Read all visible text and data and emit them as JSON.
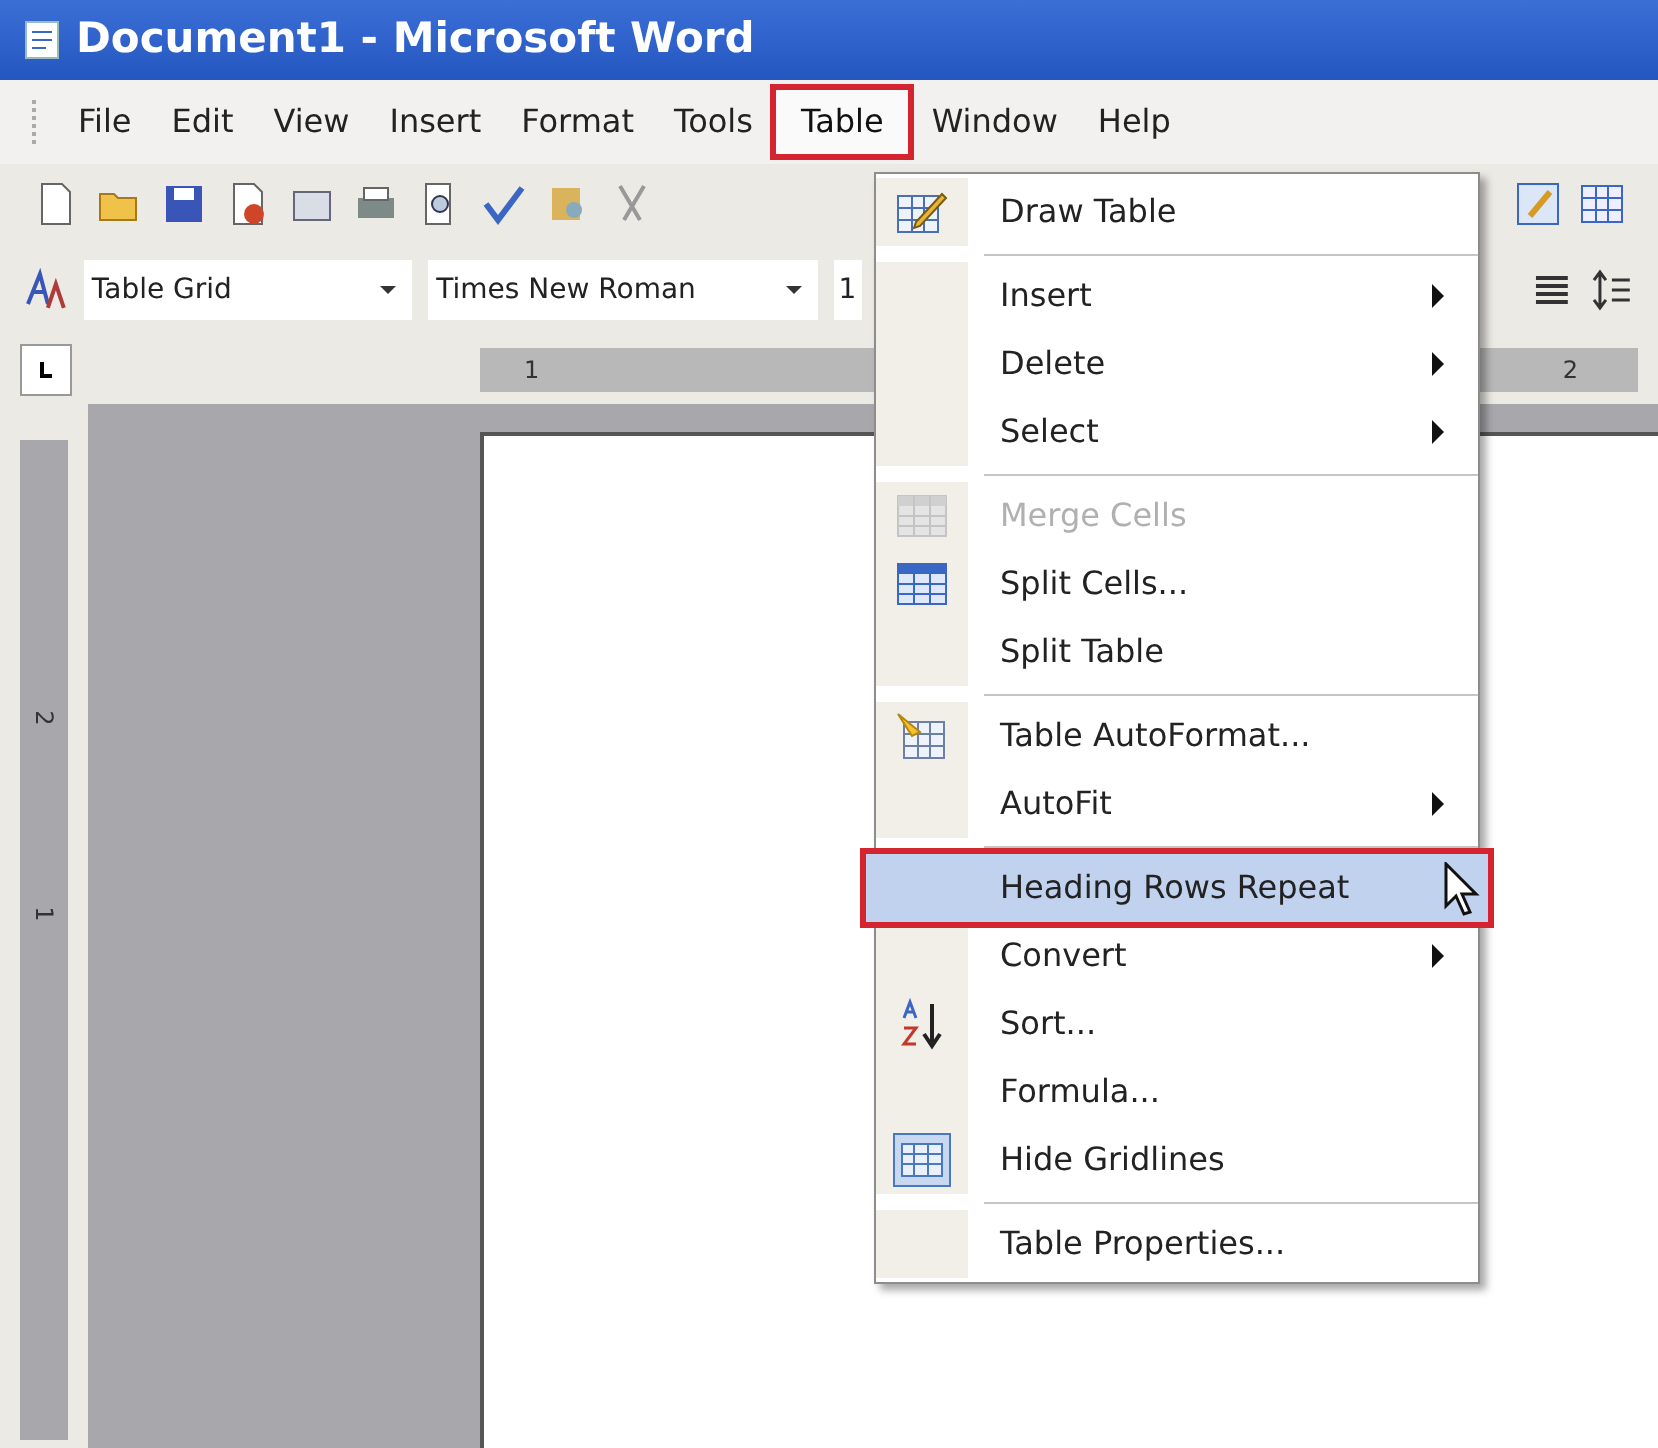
{
  "window": {
    "title": "Document1 - Microsoft Word"
  },
  "menu_bar": [
    {
      "label": "File",
      "selected": false
    },
    {
      "label": "Edit",
      "selected": false
    },
    {
      "label": "View",
      "selected": false
    },
    {
      "label": "Insert",
      "selected": false
    },
    {
      "label": "Format",
      "selected": false
    },
    {
      "label": "Tools",
      "selected": false
    },
    {
      "label": "Table",
      "selected": true
    },
    {
      "label": "Window",
      "selected": false
    },
    {
      "label": "Help",
      "selected": false
    }
  ],
  "formatting_toolbar": {
    "style": "Table Grid",
    "font": "Times New Roman",
    "size": "1"
  },
  "ruler": {
    "horizontal_labels": [
      "1",
      "2"
    ],
    "vertical_labels": [
      "2",
      "1"
    ]
  },
  "menu": {
    "items": [
      {
        "kind": "item",
        "label": "Draw Table",
        "submenu": false,
        "disabled": false,
        "selected": false
      },
      {
        "kind": "separator"
      },
      {
        "kind": "item",
        "label": "Insert",
        "submenu": true,
        "disabled": false,
        "selected": false
      },
      {
        "kind": "item",
        "label": "Delete",
        "submenu": true,
        "disabled": false,
        "selected": false
      },
      {
        "kind": "item",
        "label": "Select",
        "submenu": true,
        "disabled": false,
        "selected": false
      },
      {
        "kind": "separator"
      },
      {
        "kind": "item",
        "label": "Merge Cells",
        "submenu": false,
        "disabled": true,
        "selected": false
      },
      {
        "kind": "item",
        "label": "Split Cells...",
        "submenu": false,
        "disabled": false,
        "selected": false
      },
      {
        "kind": "item",
        "label": "Split Table",
        "submenu": false,
        "disabled": false,
        "selected": false
      },
      {
        "kind": "separator"
      },
      {
        "kind": "item",
        "label": "Table AutoFormat...",
        "submenu": false,
        "disabled": false,
        "selected": false
      },
      {
        "kind": "item",
        "label": "AutoFit",
        "submenu": true,
        "disabled": false,
        "selected": false
      },
      {
        "kind": "separator"
      },
      {
        "kind": "item",
        "label": "Heading Rows Repeat",
        "submenu": false,
        "disabled": false,
        "selected": true
      },
      {
        "kind": "item",
        "label": "Convert",
        "submenu": true,
        "disabled": false,
        "selected": false
      },
      {
        "kind": "item",
        "label": "Sort...",
        "submenu": false,
        "disabled": false,
        "selected": false
      },
      {
        "kind": "item",
        "label": "Formula...",
        "submenu": false,
        "disabled": false,
        "selected": false
      },
      {
        "kind": "item",
        "label": "Hide Gridlines",
        "submenu": false,
        "disabled": false,
        "selected": false
      },
      {
        "kind": "separator"
      },
      {
        "kind": "item",
        "label": "Table Properties...",
        "submenu": false,
        "disabled": false,
        "selected": false
      }
    ]
  }
}
